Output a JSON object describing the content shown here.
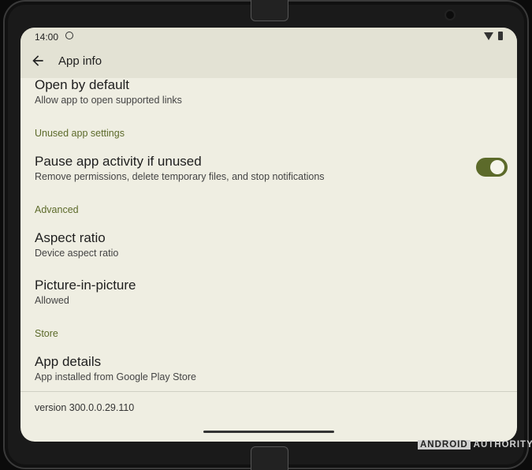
{
  "status": {
    "time": "14:00"
  },
  "appbar": {
    "title": "App info"
  },
  "rows": {
    "open_default": {
      "title": "Open by default",
      "subtitle": "Allow app to open supported links"
    },
    "pause": {
      "title": "Pause app activity if unused",
      "subtitle": "Remove permissions, delete temporary files, and stop notifications",
      "enabled": true
    },
    "aspect": {
      "title": "Aspect ratio",
      "subtitle": "Device aspect ratio"
    },
    "pip": {
      "title": "Picture-in-picture",
      "subtitle": "Allowed"
    },
    "app_details": {
      "title": "App details",
      "subtitle": "App installed from Google Play Store"
    }
  },
  "sections": {
    "unused": "Unused app settings",
    "advanced": "Advanced",
    "store": "Store"
  },
  "footer": {
    "version": "version 300.0.0.29.110"
  },
  "watermark": {
    "part1": "ANDROID",
    "part2": "AUTHORITY"
  },
  "colors": {
    "accent": "#5c6a2a",
    "background": "#efeee2",
    "appbar": "#e3e2d4"
  }
}
